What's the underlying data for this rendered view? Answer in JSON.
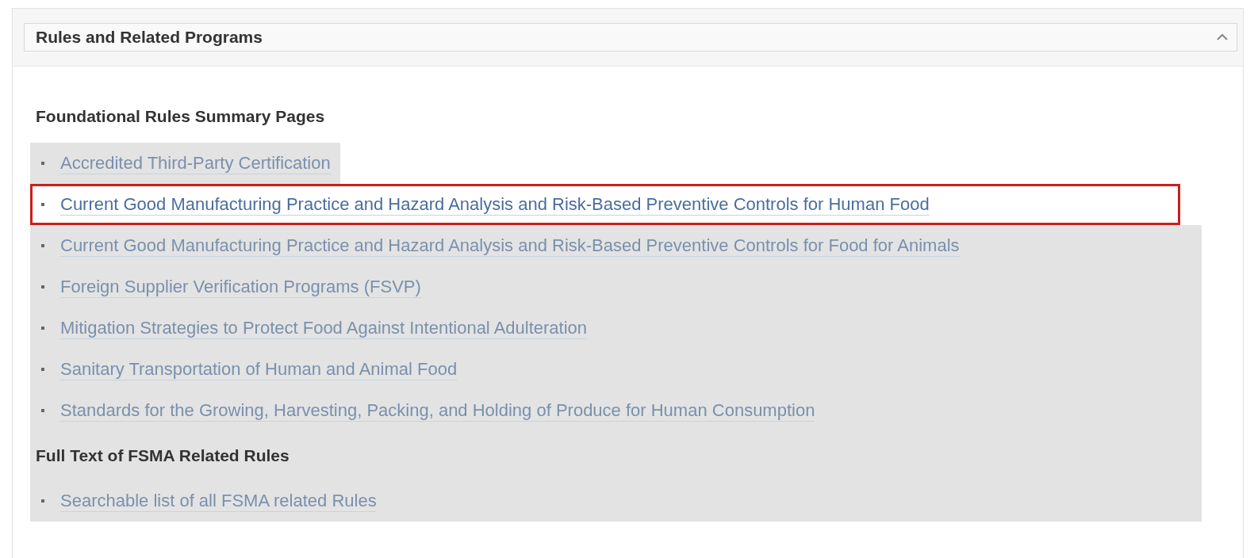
{
  "panel": {
    "title": "Rules and Related Programs",
    "expanded": true
  },
  "sections": [
    {
      "heading": "Foundational Rules Summary Pages",
      "links": [
        {
          "label": "Accredited Third-Party Certification",
          "highlighted": false
        },
        {
          "label": "Current Good Manufacturing Practice and Hazard Analysis and Risk-Based Preventive Controls for Human Food",
          "highlighted": true
        },
        {
          "label": "Current Good Manufacturing Practice and Hazard Analysis and Risk-Based Preventive Controls for Food for Animals",
          "highlighted": false
        },
        {
          "label": "Foreign Supplier Verification Programs (FSVP)",
          "highlighted": false
        },
        {
          "label": "Mitigation Strategies to Protect Food Against Intentional Adulteration",
          "highlighted": false
        },
        {
          "label": "Sanitary Transportation of Human and Animal Food",
          "highlighted": false
        },
        {
          "label": "Standards for the Growing, Harvesting, Packing, and Holding of Produce for Human Consumption",
          "highlighted": false
        }
      ]
    },
    {
      "heading": "Full Text of FSMA Related Rules",
      "links": [
        {
          "label": "Searchable list of all FSMA related Rules",
          "highlighted": false
        }
      ]
    }
  ]
}
